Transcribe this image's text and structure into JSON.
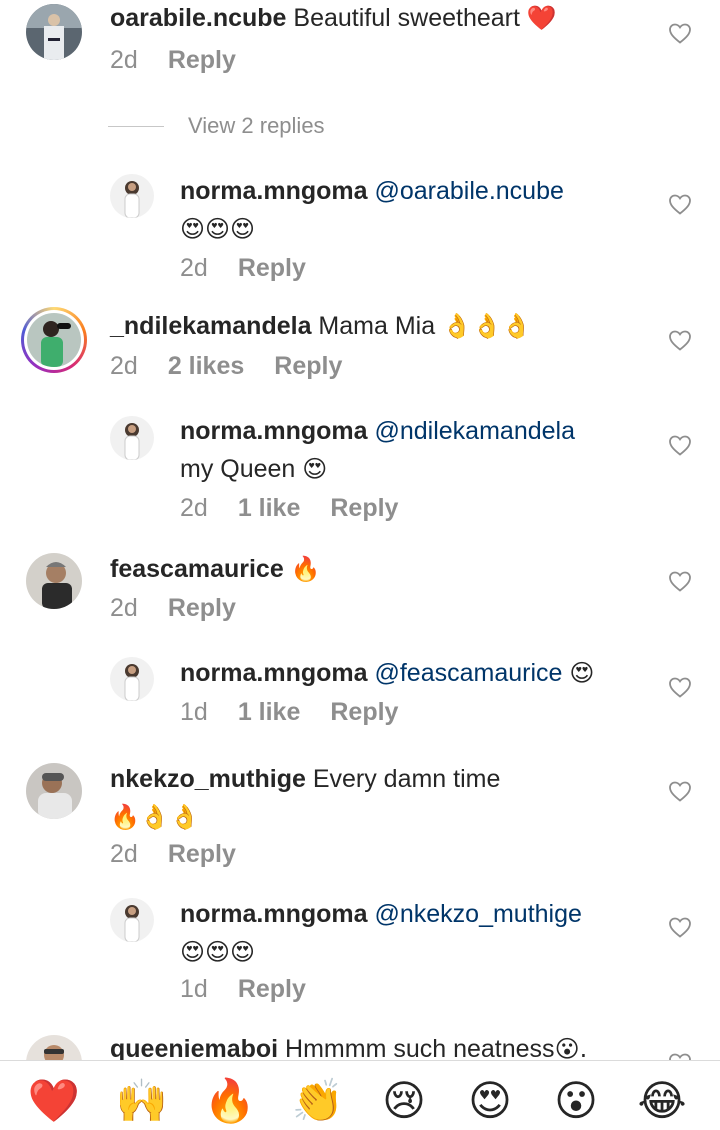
{
  "comments": [
    {
      "user": "oarabile.ncube",
      "text": " Beautiful sweetheart ",
      "emoji": "❤️",
      "time": "2d",
      "likes": "",
      "reply": "Reply",
      "view_replies": "View 2 replies"
    },
    {
      "user": "norma.mngoma",
      "mention": "@oarabile.ncube",
      "text": "",
      "emoji_line": "😍😍😍",
      "time": "2d",
      "likes": "",
      "reply": "Reply"
    },
    {
      "user": "_ndilekamandela",
      "text": " Mama Mia ",
      "emoji": "👌👌👌",
      "time": "2d",
      "likes": "2 likes",
      "reply": "Reply"
    },
    {
      "user": "norma.mngoma",
      "mention": "@ndilekamandela",
      "text": "my Queen ",
      "emoji": "😍",
      "time": "2d",
      "likes": "1 like",
      "reply": "Reply"
    },
    {
      "user": "feascamaurice",
      "text": " ",
      "emoji": "🔥",
      "time": "2d",
      "likes": "",
      "reply": "Reply"
    },
    {
      "user": "norma.mngoma",
      "mention": "@feascamaurice",
      "text": " ",
      "emoji": "😍",
      "time": "1d",
      "likes": "1 like",
      "reply": "Reply"
    },
    {
      "user": "nkekzo_muthige",
      "text": " Every damn time",
      "emoji_line": "🔥👌👌",
      "time": "2d",
      "likes": "",
      "reply": "Reply"
    },
    {
      "user": "norma.mngoma",
      "mention": "@nkekzo_muthige",
      "text": "",
      "emoji_line": "😍😍😍",
      "time": "1d",
      "likes": "",
      "reply": "Reply"
    },
    {
      "user": "queeniemaboi",
      "text": " Hmmmm such neatness",
      "emoji": "😮.",
      "time": "",
      "likes": "",
      "reply": ""
    }
  ],
  "quick_reactions": [
    "❤️",
    "🙌",
    "🔥",
    "👏",
    "😢",
    "😍",
    "😮",
    "😂"
  ],
  "icons": {
    "like": "heart-outline-icon"
  },
  "colors": {
    "mention": "#003569",
    "meta": "#8e8e8e",
    "text": "#262626"
  }
}
